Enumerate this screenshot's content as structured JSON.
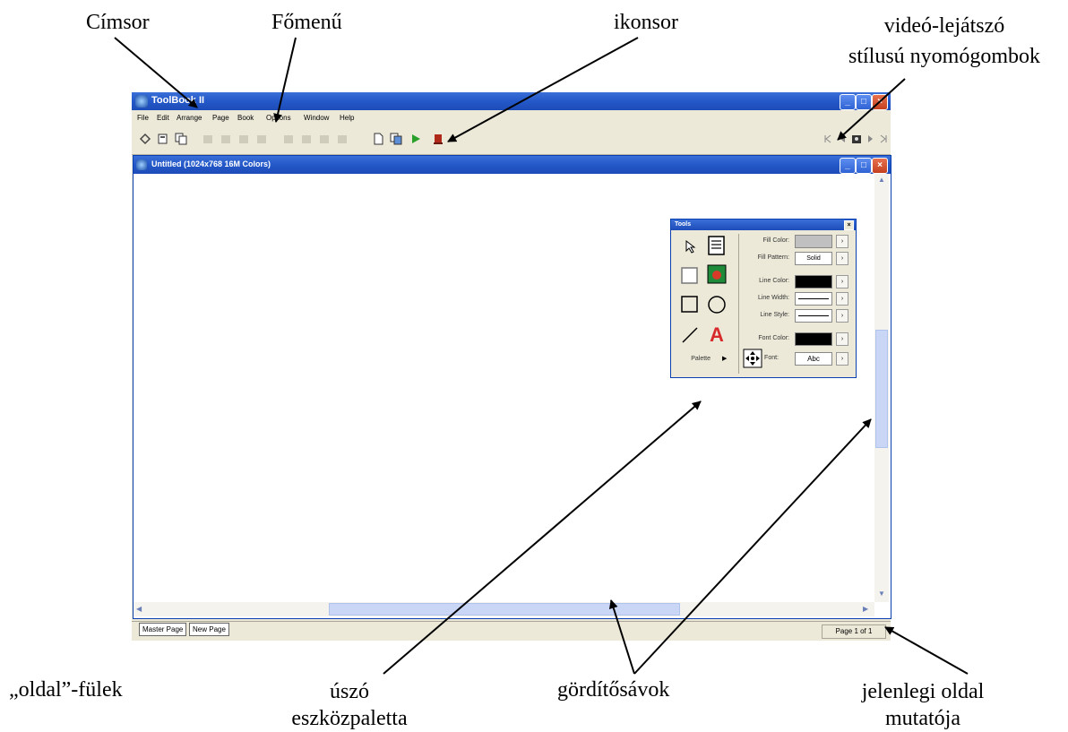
{
  "annotations": {
    "cimsor": "Címsor",
    "fomenu": "Főmenű",
    "ikonsor": "ikonsor",
    "video_line1": "videó-lejátszó",
    "video_line2": "stílusú nyomógombok",
    "oldal_fulek": "„oldal”-fülek",
    "uszo_line1": "úszó",
    "uszo_line2": "eszközpaletta",
    "gorditosavok": "gördítősávok",
    "jelenlegi_line1": "jelenlegi oldal",
    "jelenlegi_line2": "mutatója"
  },
  "app": {
    "title": "ToolBook II",
    "menu": [
      "File",
      "Edit",
      "Arrange",
      "Page",
      "Book",
      "Options",
      "Window",
      "Help"
    ],
    "window_buttons": [
      "minimize",
      "maximize",
      "close"
    ]
  },
  "toolbar": {
    "icons": [
      "pointer-icon",
      "book-icon",
      "copy-icon",
      "new-page-icon",
      "pages-icon",
      "play-icon",
      "stop-icon"
    ],
    "nav_icons": [
      "first-page-icon",
      "prev-page-icon",
      "camera-icon",
      "next-page-icon",
      "last-page-icon"
    ]
  },
  "document": {
    "title": "Untitled (1024x768 16M Colors)"
  },
  "page_tabs": [
    "Master Page",
    "New Page"
  ],
  "page_indicator": "Page 1 of 1",
  "tools_palette": {
    "title": "Tools",
    "palette_label": "Palette",
    "fill_color_label": "Fill Color:",
    "fill_pattern_label": "Fill Pattern:",
    "fill_pattern_value": "Solid",
    "line_color_label": "Line Color:",
    "line_width_label": "Line Width:",
    "line_style_label": "Line Style:",
    "font_color_label": "Font Color:",
    "font_label": "Font:",
    "font_value": "Abc",
    "fill_color": "#c0c0c0",
    "line_color": "#000000",
    "font_color": "#000000"
  }
}
